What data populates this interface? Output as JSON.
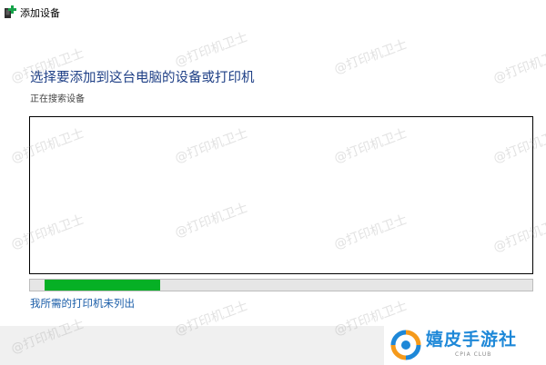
{
  "window": {
    "title": "添加设备",
    "icon": "add-device-icon"
  },
  "main": {
    "heading": "选择要添加到这台电脑的设备或打印机",
    "status": "正在搜索设备",
    "progress_percent": 23,
    "not_listed_link": "我所需的打印机未列出"
  },
  "watermark": {
    "text": "@打印机卫士"
  },
  "brand": {
    "name": "嬉皮手游社",
    "subtitle": "CPIA CLUB"
  },
  "colors": {
    "heading": "#1e3f86",
    "link": "#1a5da8",
    "progress": "#06b025",
    "brand": "#1e88d8"
  }
}
